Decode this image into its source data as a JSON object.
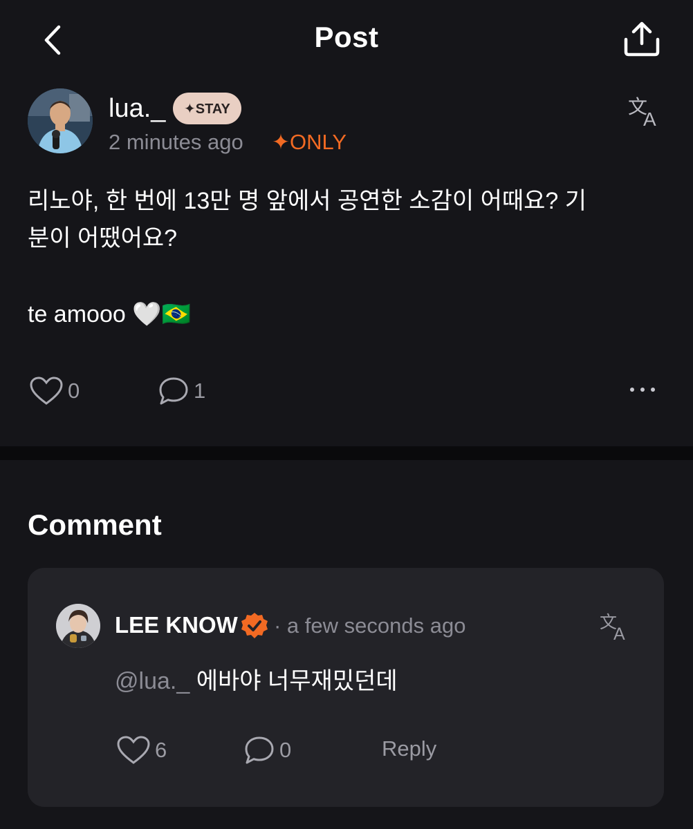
{
  "header": {
    "title": "Post",
    "back_icon": "chevron-left-icon",
    "share_icon": "share-upload-icon"
  },
  "post": {
    "username": "lua._",
    "badge": "✦STAY",
    "time": "2 minutes ago",
    "only_label": "✦ONLY",
    "translate_icon": "translate-icon",
    "body_line1": "리노야, 한 번에 13만 명 앞에서 공연한 소감이 어때요? 기",
    "body_line2": "분이 어땠어요?",
    "body_line3": "te amooo 🤍🇧🇷",
    "likes": "0",
    "comments": "1"
  },
  "comments_section": {
    "heading": "Comment",
    "items": [
      {
        "author": "LEE KNOW",
        "verified": true,
        "time": "· a few seconds ago",
        "mention": "@lua._",
        "text": " 에바야 너무재밌던데",
        "likes": "6",
        "replies": "0",
        "reply_label": "Reply"
      }
    ]
  },
  "colors": {
    "background": "#151519",
    "card": "#232328",
    "accent_orange": "#f26a23",
    "badge_bg": "#e9cfc3",
    "muted_text": "#8c8c95"
  }
}
